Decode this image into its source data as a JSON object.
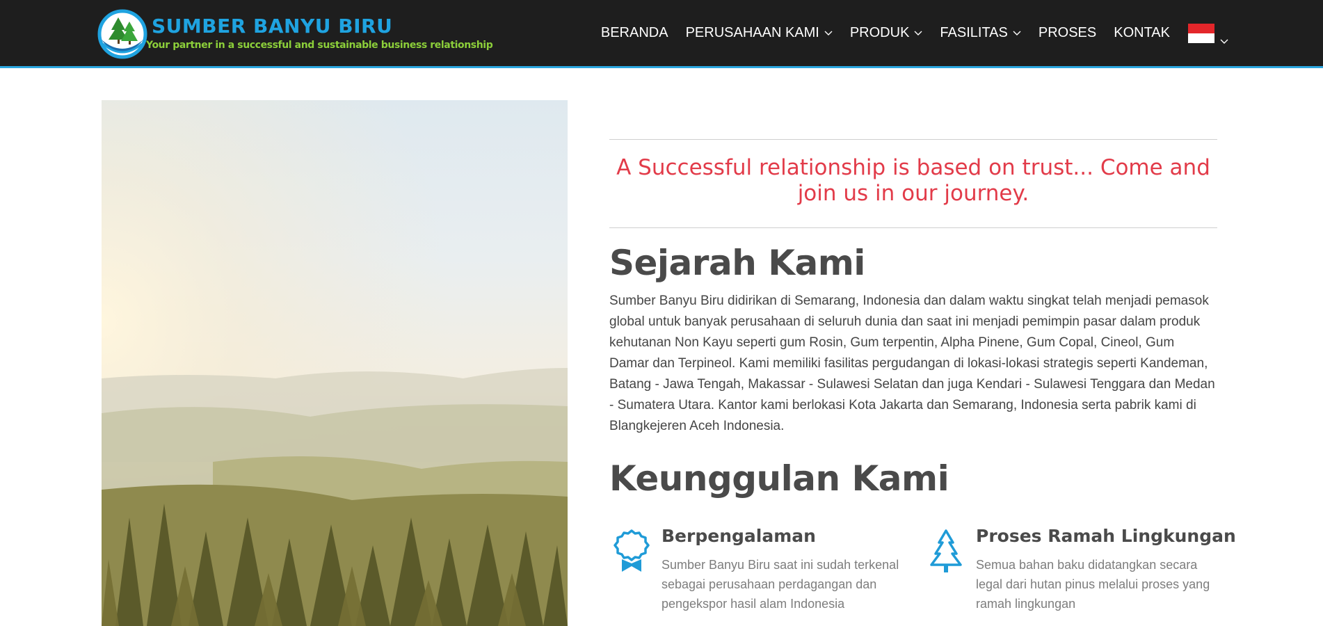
{
  "brand": {
    "title": "SUMBER BANYU BIRU",
    "tagline": "Your partner in a successful and sustainable business relationship"
  },
  "nav": {
    "items": [
      {
        "label": "BERANDA",
        "dropdown": false
      },
      {
        "label": "PERUSAHAAN KAMI",
        "dropdown": true
      },
      {
        "label": "PRODUK",
        "dropdown": true
      },
      {
        "label": "FASILITAS",
        "dropdown": true
      },
      {
        "label": "PROSES",
        "dropdown": false
      },
      {
        "label": "KONTAK",
        "dropdown": false
      }
    ],
    "language_flag": "indonesia-flag-icon"
  },
  "colors": {
    "navbar_bg": "#1e1e1e",
    "accent_blue": "#2aa6df",
    "quote_red": "#e23b49",
    "logo_green": "#8ccf3a"
  },
  "hero_image": {
    "alt": "forest-landscape-image"
  },
  "quote": "A Successful relationship is based on trust... Come and join us in our journey.",
  "history": {
    "title_bold": "Sejarah",
    "title_rest": " Kami",
    "body": "Sumber Banyu Biru didirikan di Semarang, Indonesia dan dalam waktu singkat telah menjadi pemasok global untuk banyak perusahaan di seluruh dunia dan saat ini menjadi pemimpin pasar dalam produk kehutanan Non Kayu seperti gum Rosin, Gum terpentin, Alpha Pinene, Gum Copal, Cineol, Gum Damar dan Terpineol. Kami memiliki fasilitas pergudangan di lokasi-lokasi strategis seperti Kandeman, Batang - Jawa Tengah, Makassar - Sulawesi Selatan dan juga Kendari - Sulawesi Tenggara dan Medan - Sumatera Utara. Kantor kami berlokasi Kota Jakarta dan Semarang, Indonesia serta pabrik kami di Blangkejeren Aceh Indonesia."
  },
  "advantages": {
    "title_bold": "Keunggulan",
    "title_rest": " Kami",
    "items": [
      {
        "icon": "award-ribbon-icon",
        "title": "Berpengalaman",
        "text": "Sumber Banyu Biru saat ini sudah terkenal sebagai perusahaan perdagangan dan pengekspor hasil alam Indonesia"
      },
      {
        "icon": "pine-tree-icon",
        "title": "Proses Ramah Lingkungan",
        "text": "Semua bahan baku didatangkan secara legal dari hutan pinus melalui proses yang ramah lingkungan"
      }
    ]
  }
}
